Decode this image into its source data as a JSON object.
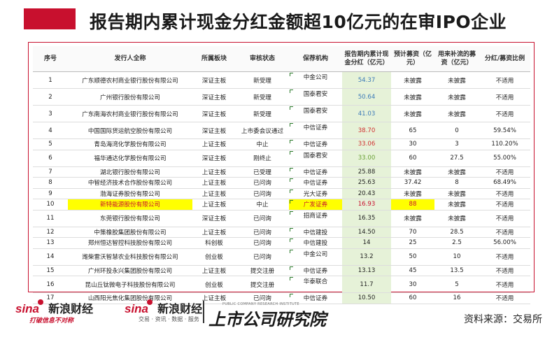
{
  "title": "报告期内累计现金分红金额超10亿元的在审IPO企业",
  "colors": {
    "accent": "#c8102e",
    "cap_bg": "#e6f2d8",
    "highlight": "#ffff00"
  },
  "headers": [
    "序号",
    "发行人全称",
    "所属板块",
    "审核状态",
    "保荐机构",
    "报告期内累计现金分红（亿元）",
    "预计募资（亿元）",
    "用来补流的募资（亿元）",
    "分红/募资比例"
  ],
  "rows": [
    {
      "no": "1",
      "issuer": "广东顺德农村商业银行股份有限公司",
      "board": "深证主板",
      "status": "新受理",
      "agent": "中金公司",
      "cap": "54.37",
      "raise": "未披露",
      "liquidity": "未披露",
      "ratio": "不适用",
      "capColor": "blue",
      "tall": true,
      "agentTop": true
    },
    {
      "no": "2",
      "issuer": "广州银行股份有限公司",
      "board": "深证主板",
      "status": "新受理",
      "agent": "国泰君安",
      "cap": "50.64",
      "raise": "未披露",
      "liquidity": "未披露",
      "ratio": "不适用",
      "capColor": "blue",
      "tall": true,
      "agentTop": true
    },
    {
      "no": "3",
      "issuer": "广东南海农村商业银行股份有限公司",
      "board": "深证主板",
      "status": "新受理",
      "agent": "国泰君安",
      "cap": "41.03",
      "raise": "未披露",
      "liquidity": "未披露",
      "ratio": "不适用",
      "capColor": "blue",
      "tall": true,
      "agentTop": true
    },
    {
      "no": "4",
      "issuer": "中国国际货运航空股份有限公司",
      "board": "深证主板",
      "status": "上市委会议通过",
      "agent": "中信证券",
      "cap": "38.70",
      "raise": "65",
      "liquidity": "0",
      "ratio": "59.54%",
      "capColor": "red",
      "tall": true,
      "agentTop": true
    },
    {
      "no": "5",
      "issuer": "青岛海湾化学股份有限公司",
      "board": "上证主板",
      "status": "中止",
      "agent": "中信证券",
      "cap": "33.06",
      "raise": "30",
      "liquidity": "3",
      "ratio": "110.20%",
      "capColor": "red",
      "tall": false
    },
    {
      "no": "6",
      "issuer": "福华通达化学股份有限公司",
      "board": "深证主板",
      "status": "刚终止",
      "agent": "国泰君安",
      "cap": "33.00",
      "raise": "60",
      "liquidity": "27.5",
      "ratio": "55.00%",
      "capColor": "green",
      "tall": true,
      "agentTop": true
    },
    {
      "no": "7",
      "issuer": "湖北银行股份有限公司",
      "board": "上证主板",
      "status": "已受理",
      "agent": "中信证券",
      "cap": "25.88",
      "raise": "未披露",
      "liquidity": "未披露",
      "ratio": "不适用",
      "capColor": "",
      "tall": false
    },
    {
      "no": "8",
      "issuer": "中智经济技术合作股份有限公司",
      "board": "上证主板",
      "status": "已问询",
      "agent": "中信证券",
      "cap": "25.63",
      "raise": "37.42",
      "liquidity": "8",
      "ratio": "68.49%",
      "capColor": "",
      "tall": false
    },
    {
      "no": "9",
      "issuer": "渤海证券股份有限公司",
      "board": "上证主板",
      "status": "已问询",
      "agent": "光大证券",
      "cap": "20.43",
      "raise": "未披露",
      "liquidity": "未披露",
      "ratio": "不适用",
      "capColor": "",
      "tall": false
    },
    {
      "no": "10",
      "issuer": "新特能源股份有限公司",
      "board": "上证主板",
      "status": "中止",
      "agent": "广发证券",
      "cap": "16.93",
      "raise": "88",
      "liquidity": "未披露",
      "ratio": "不适用",
      "capColor": "",
      "tall": false,
      "highlight": true
    },
    {
      "no": "11",
      "issuer": "东莞银行股份有限公司",
      "board": "深证主板",
      "status": "已问询",
      "agent": "招商证券",
      "cap": "16.35",
      "raise": "未披露",
      "liquidity": "未披露",
      "ratio": "不适用",
      "capColor": "",
      "tall": true,
      "agentTop": true
    },
    {
      "no": "12",
      "issuer": "中策橡胶集团股份有限公司",
      "board": "上证主板",
      "status": "已问询",
      "agent": "中信建投",
      "cap": "14.50",
      "raise": "70",
      "liquidity": "28.5",
      "ratio": "不适用",
      "capColor": "",
      "tall": false
    },
    {
      "no": "13",
      "issuer": "郑州恒达智控科技股份有限公司",
      "board": "科创板",
      "status": "已问询",
      "agent": "中信建投",
      "cap": "14",
      "raise": "25",
      "liquidity": "2.5",
      "ratio": "56.00%",
      "capColor": "",
      "tall": false
    },
    {
      "no": "14",
      "issuer": "潍柴雷沃智慧农业科技股份有限公司",
      "board": "创业板",
      "status": "已问询",
      "agent": "中金公司",
      "cap": "13.2",
      "raise": "50",
      "liquidity": "10",
      "ratio": "不适用",
      "capColor": "",
      "tall": true,
      "agentTop": true
    },
    {
      "no": "15",
      "issuer": "广州环投永兴集团股份有限公司",
      "board": "上证主板",
      "status": "提交注册",
      "agent": "中信证券",
      "cap": "13.13",
      "raise": "45",
      "liquidity": "13.5",
      "ratio": "不适用",
      "capColor": "",
      "tall": false
    },
    {
      "no": "16",
      "issuer": "昆山丘钛微电子科技股份有限公司",
      "board": "创业板",
      "status": "提交注册",
      "agent": "华泰联合",
      "cap": "11.7",
      "raise": "30",
      "liquidity": "5",
      "ratio": "不适用",
      "capColor": "",
      "tall": true,
      "agentTop": true
    },
    {
      "no": "17",
      "issuer": "山西阳光焦化集团股份有限公司",
      "board": "上证主板",
      "status": "已问询",
      "agent": "中信证券",
      "cap": "10.50",
      "raise": "60",
      "liquidity": "16",
      "ratio": "不适用",
      "capColor": "",
      "tall": false
    }
  ],
  "footer": {
    "logo1_mark": "sina",
    "logo1_name": "新浪财经",
    "logo1_slogan": "打破信息不对称",
    "logo2_mark": "sina",
    "logo2_name": "新浪财经",
    "logo2_slogan": "交易 · 资讯 · 数据 · 服务",
    "research_en": "PUBLIC COMPANY RESEARCH INSTITUTE",
    "research_cn": "上市公司研究院",
    "source": "资料来源：交易所"
  }
}
